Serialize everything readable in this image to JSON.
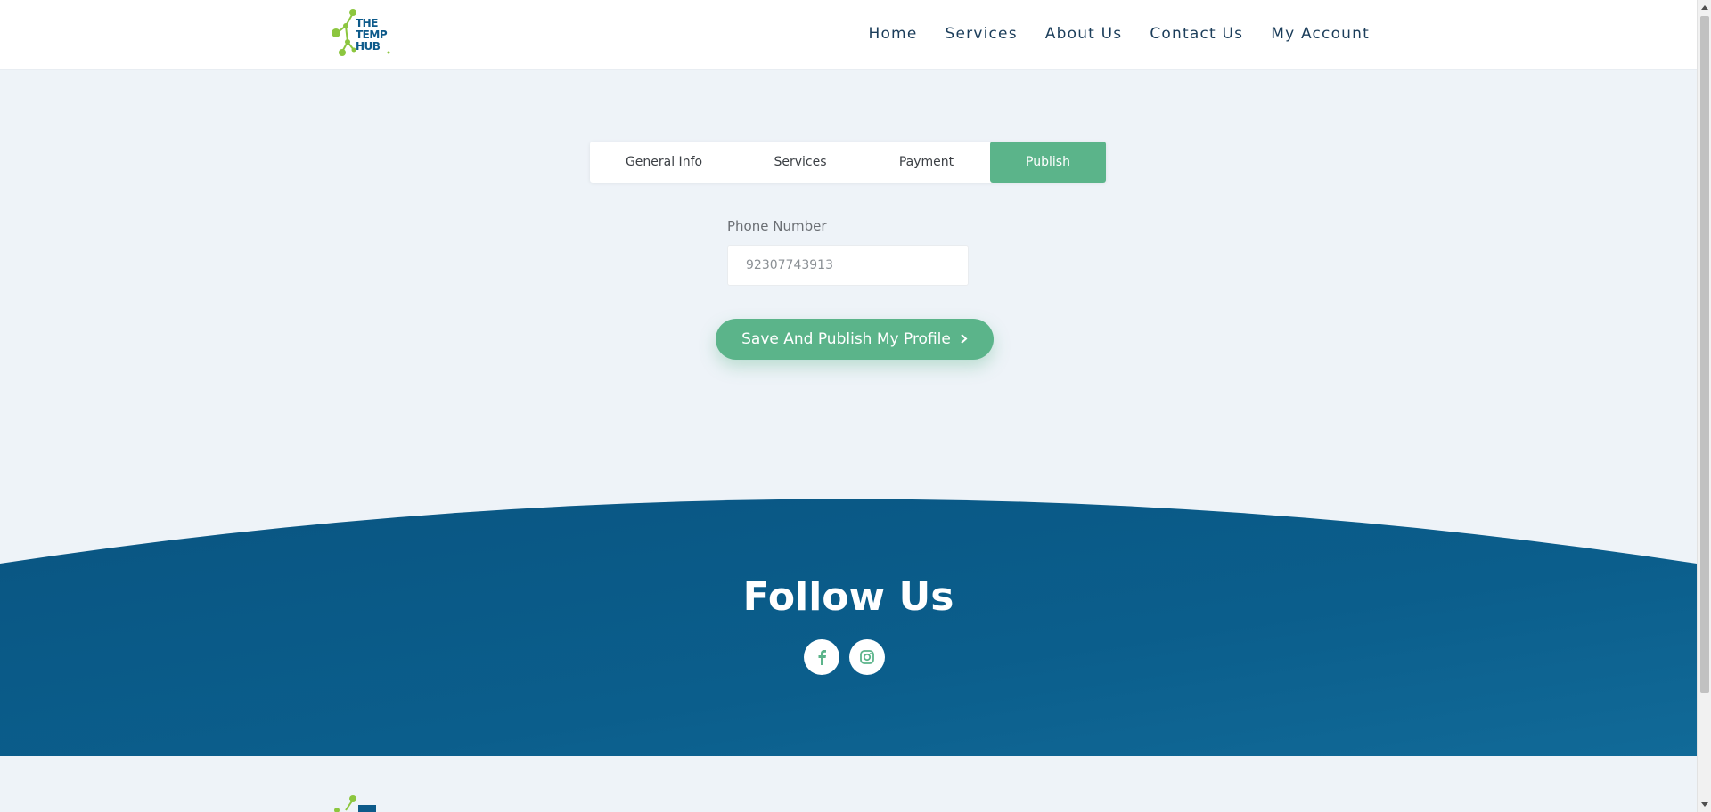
{
  "brand": {
    "logo_lines": [
      "THE",
      "TEMP",
      "HUB"
    ],
    "logo_color": "#0d5a8a",
    "accent_color": "#8cc63f"
  },
  "nav": {
    "items": [
      {
        "label": "Home"
      },
      {
        "label": "Services"
      },
      {
        "label": "About Us"
      },
      {
        "label": "Contact Us"
      },
      {
        "label": "My Account"
      }
    ]
  },
  "tabs": {
    "items": [
      {
        "label": "General Info"
      },
      {
        "label": "Services"
      },
      {
        "label": "Payment"
      },
      {
        "label": "Publish"
      }
    ],
    "active": "Publish",
    "active_color": "#5bb48a"
  },
  "form": {
    "phone_label": "Phone Number",
    "phone_value": "92307743913",
    "submit_label": "Save And Publish My Profile"
  },
  "footer": {
    "title": "Follow Us",
    "background_color": "#0b5c8a",
    "socials": [
      {
        "icon": "facebook-icon"
      },
      {
        "icon": "instagram-icon"
      }
    ]
  }
}
